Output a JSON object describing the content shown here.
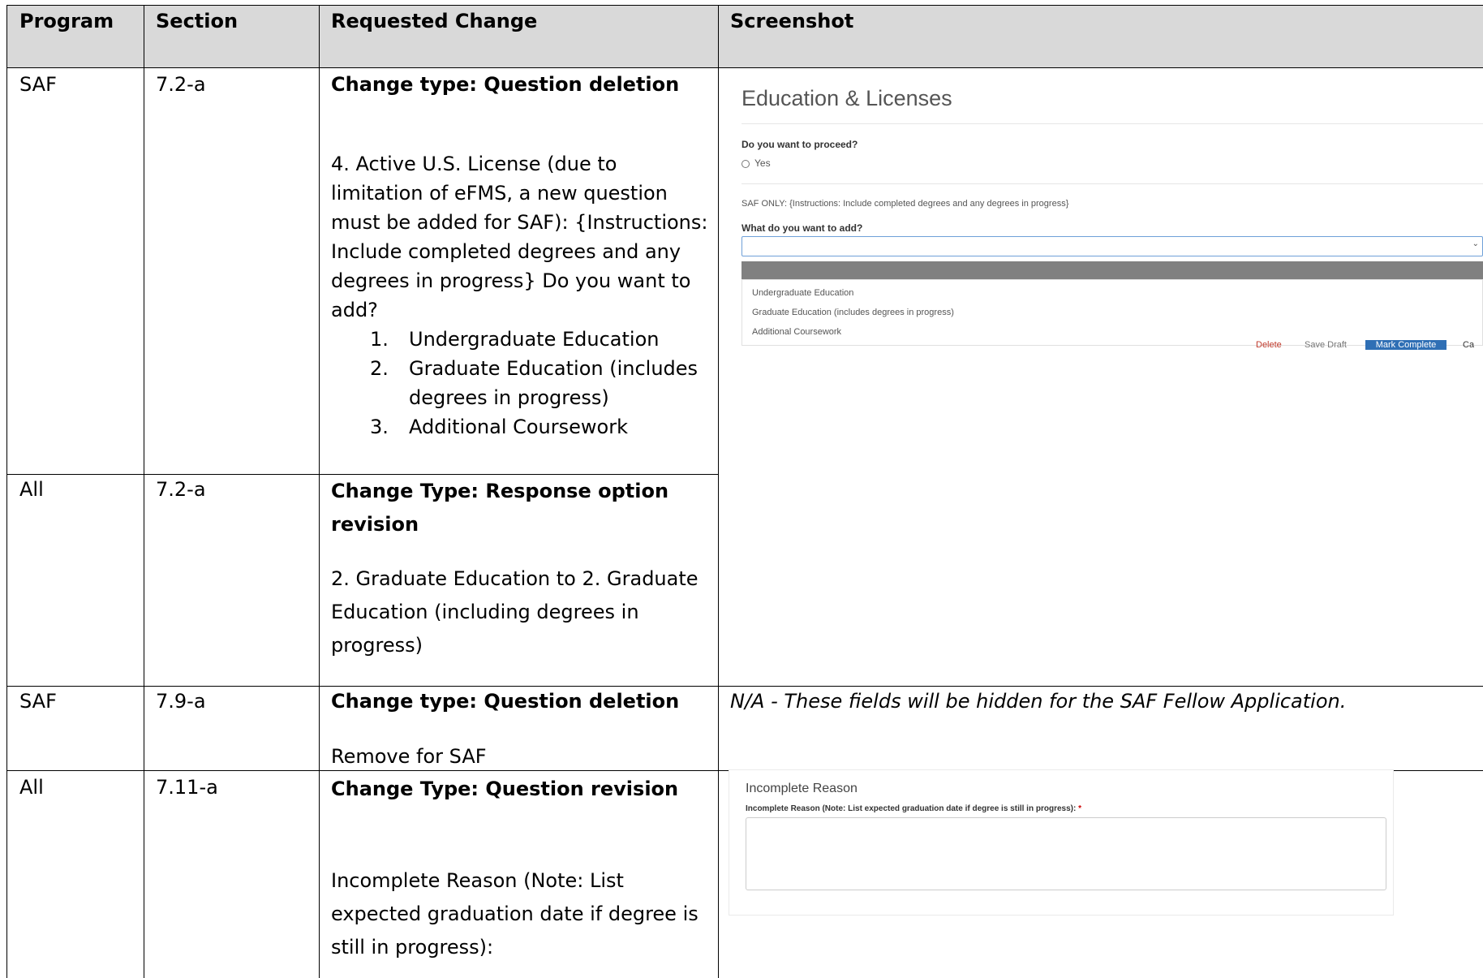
{
  "headers": {
    "program": "Program",
    "section": "Section",
    "change": "Requested Change",
    "screenshot": "Screenshot"
  },
  "rows": [
    {
      "program": "SAF",
      "section": "7.2-a",
      "change_type": "Change type:  Question deletion",
      "body": "4. Active U.S. License (due to limitation of eFMS, a new question must be added for SAF): {Instructions: Include completed degrees and any degrees in progress} Do you want to add?",
      "items": [
        {
          "num": "1.",
          "text": "Undergraduate Education"
        },
        {
          "num": "2.",
          "text": "Graduate Education (includes degrees in progress)"
        },
        {
          "num": "3.",
          "text": "Additional Coursework"
        }
      ]
    },
    {
      "program": "All",
      "section": "7.2-a",
      "change_type": "Change Type: Response option revision",
      "body": "2. Graduate Education to 2. Graduate Education (including degrees in progress)"
    },
    {
      "program": "SAF",
      "section": "7.9-a",
      "change_type": "Change type:  Question deletion",
      "body": "Remove for SAF",
      "screenshot_note": "N/A - These fields will be hidden for the SAF Fellow Application."
    },
    {
      "program": "All",
      "section": "7.11-a",
      "change_type": "Change Type: Question revision",
      "body": "Incomplete Reason (Note: List expected graduation date if degree is still in progress):"
    }
  ],
  "screenshot1": {
    "title": "Education & Licenses",
    "proceed_label": "Do you want to proceed?",
    "yes_option": "Yes",
    "instructions": "SAF ONLY: {Instructions: Include completed degrees and any degrees in progress}",
    "add_label": "What do you want to add?",
    "options": [
      "Undergraduate Education",
      "Graduate Education (includes degrees in progress)",
      "Additional Coursework"
    ],
    "behind_buttons": [
      "Delete",
      "Save Draft",
      "Mark Complete",
      "Ca"
    ]
  },
  "screenshot2": {
    "title": "Incomplete Reason",
    "label": "Incomplete Reason (Note: List expected graduation date if degree is still in progress):",
    "required_mark": "*"
  }
}
